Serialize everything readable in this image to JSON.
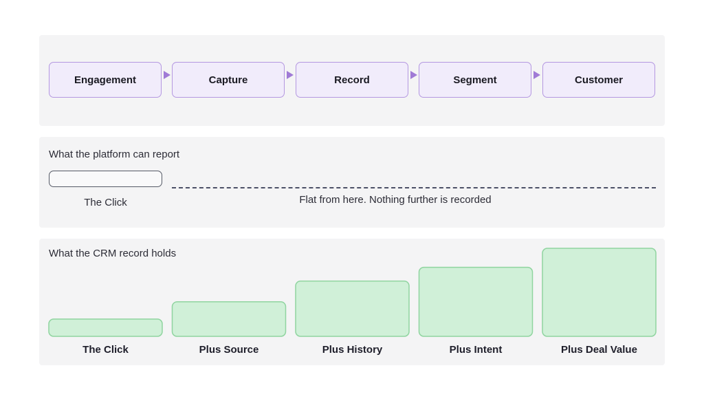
{
  "flow": {
    "steps": [
      "Engagement",
      "Capture",
      "Record",
      "Segment",
      "Customer"
    ]
  },
  "platform": {
    "title": "What the platform can report",
    "click_label": "The Click",
    "flat_label": "Flat from here. Nothing further is recorded"
  },
  "crm": {
    "title": "What the CRM record holds"
  },
  "chart_data": {
    "type": "bar",
    "categories": [
      "The Click",
      "Plus Source",
      "Plus History",
      "Plus Intent",
      "Plus Deal Value"
    ],
    "values": [
      1,
      2,
      3.2,
      4,
      5.1
    ],
    "ylim": [
      0,
      5.1
    ],
    "grid": false
  },
  "colors": {
    "step_fill": "#f1ecfb",
    "step_border": "#b497e0",
    "arrow": "#a07ad6",
    "bar_fill": "#d0f0d8",
    "bar_border": "#8fd49f",
    "dash": "#4b4f66"
  }
}
